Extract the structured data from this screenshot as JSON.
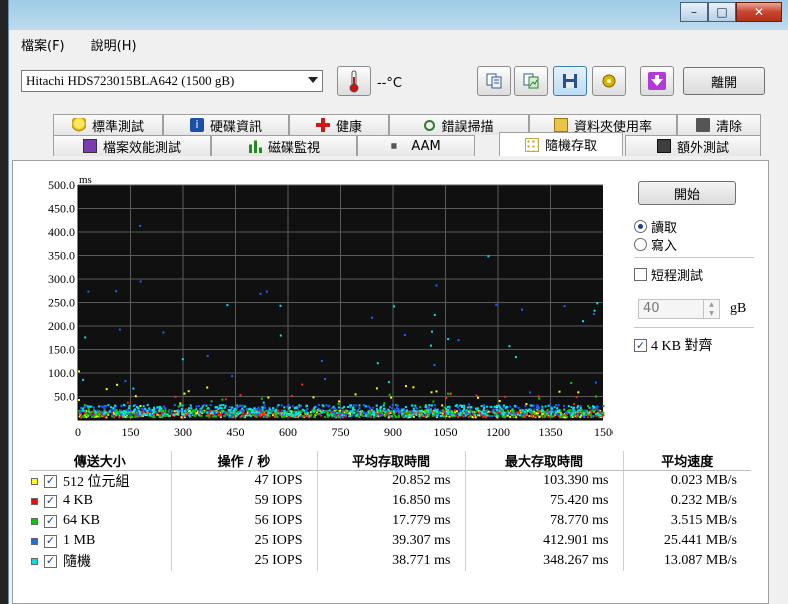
{
  "menu": {
    "file": "檔案(F)",
    "help": "說明(H)"
  },
  "toolbar": {
    "drive": "Hitachi HDS723015BLA642 (1500 gB)",
    "temperature": "--°C",
    "exit_label": "離開",
    "icons": [
      "thermometer-icon",
      "copy-text-icon",
      "copy-screen-icon",
      "save-icon",
      "save-settings-icon",
      "download-icon"
    ]
  },
  "tabs": {
    "row1": [
      "標準測試",
      "硬碟資訊",
      "健康",
      "錯誤掃描",
      "資料夾使用率",
      "清除"
    ],
    "row2": [
      "檔案效能測試",
      "磁碟監視",
      "AAM",
      "隨機存取",
      "額外測試"
    ],
    "active": "隨機存取"
  },
  "side": {
    "start_label": "開始",
    "read_label": "讀取",
    "write_label": "寫入",
    "short_test_label": "短程測試",
    "short_test_value": "40",
    "unit": "gB",
    "align_label": "4 KB 對齊"
  },
  "chart_data": {
    "type": "scatter",
    "ylabel": "ms",
    "xlabel": "",
    "y_ticks": [
      "500.0",
      "450.0",
      "400.0",
      "350.0",
      "300.0",
      "250.0",
      "200.0",
      "150.0",
      "100.0",
      "50.0"
    ],
    "x_ticks": [
      "0",
      "150",
      "300",
      "450",
      "600",
      "750",
      "900",
      "1050",
      "1200",
      "1350",
      "1500gB"
    ],
    "ylim": [
      0,
      500
    ],
    "xlim": [
      0,
      1500
    ],
    "grid": true,
    "background": "#101010",
    "series": [
      {
        "name": "512 位元組",
        "color": "#ffff00",
        "typical_ms": 12,
        "max_ms": 103.39
      },
      {
        "name": "4 KB",
        "color": "#ff2020",
        "typical_ms": 12,
        "max_ms": 75.42
      },
      {
        "name": "64 KB",
        "color": "#00d000",
        "typical_ms": 13,
        "max_ms": 78.77
      },
      {
        "name": "1 MB",
        "color": "#2060ff",
        "typical_ms": 20,
        "max_ms": 412.901
      },
      {
        "name": "隨機",
        "color": "#00e8e8",
        "typical_ms": 20,
        "max_ms": 348.267
      }
    ]
  },
  "table": {
    "headers": [
      "傳送大小",
      "操作 / 秒",
      "平均存取時間",
      "最大存取時間",
      "平均速度"
    ],
    "rows": [
      {
        "label": "512 位元組",
        "color": "#ffff00",
        "ops": "47 IOPS",
        "avg": "20.852 ms",
        "max": "103.390 ms",
        "speed": "0.023 MB/s"
      },
      {
        "label": "4 KB",
        "color": "#ff0000",
        "ops": "59 IOPS",
        "avg": "16.850 ms",
        "max": "75.420 ms",
        "speed": "0.232 MB/s"
      },
      {
        "label": "64 KB",
        "color": "#00cc00",
        "ops": "56 IOPS",
        "avg": "17.779 ms",
        "max": "78.770 ms",
        "speed": "3.515 MB/s"
      },
      {
        "label": "1 MB",
        "color": "#1e6fe0",
        "ops": "25 IOPS",
        "avg": "39.307 ms",
        "max": "412.901 ms",
        "speed": "25.441 MB/s"
      },
      {
        "label": "隨機",
        "color": "#00e0e0",
        "ops": "25 IOPS",
        "avg": "38.771 ms",
        "max": "348.267 ms",
        "speed": "13.087 MB/s"
      }
    ]
  }
}
